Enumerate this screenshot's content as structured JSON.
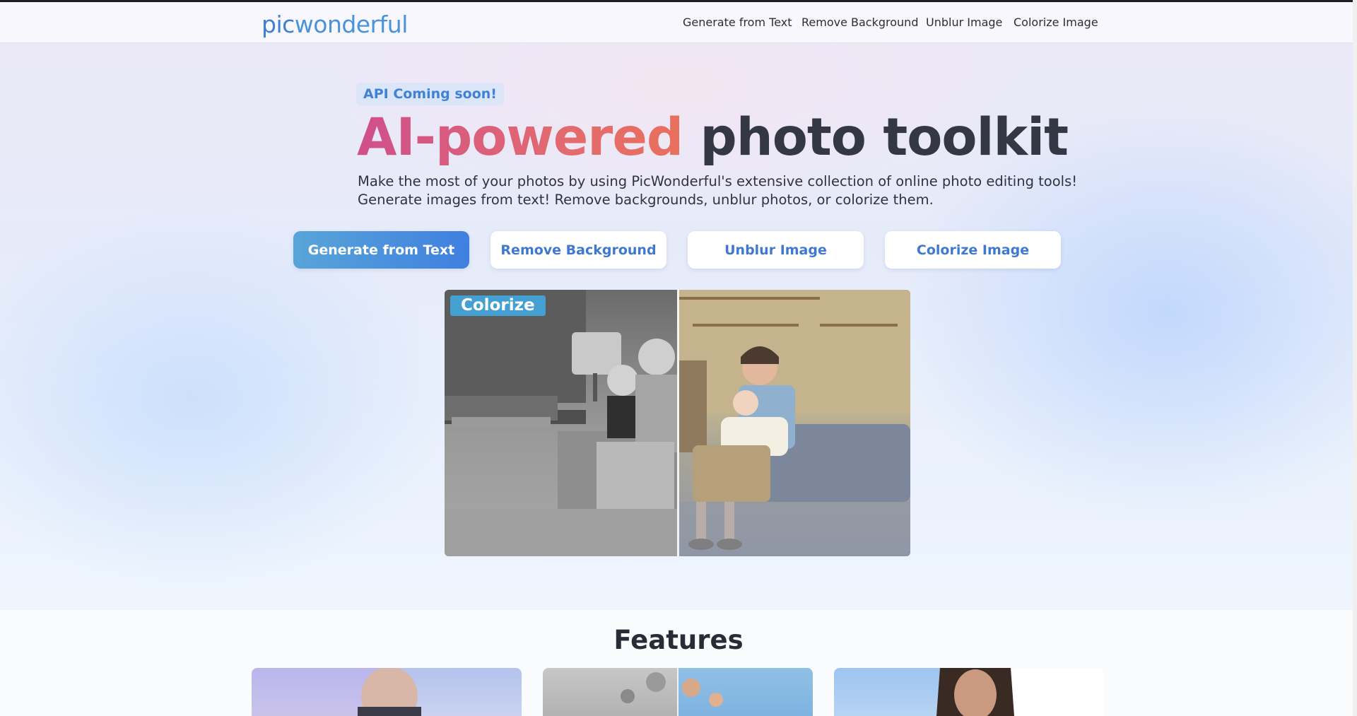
{
  "header": {
    "logo_left": "pic",
    "logo_right": "wonderful",
    "nav": [
      "Generate from Text",
      "Remove Background",
      "Unblur Image",
      "Colorize Image"
    ]
  },
  "hero": {
    "badge": "API Coming soon!",
    "headline_accent": "AI-powered",
    "headline_rest": "photo toolkit",
    "sub_line1": "Make the most of your photos by using PicWonderful's extensive collection of online photo editing tools!",
    "sub_line2": "Generate images from text! Remove backgrounds, unblur photos, or colorize them.",
    "buttons": [
      "Generate from Text",
      "Remove Background",
      "Unblur Image",
      "Colorize Image"
    ],
    "showcase_tag": "Colorize"
  },
  "features": {
    "title": "Features"
  },
  "colors": {
    "accent_blue": "#3f79cf",
    "accent_gradient_start": "#cf4f8b",
    "accent_gradient_end": "#e9705c",
    "tag_bg": "#45a0d2"
  }
}
